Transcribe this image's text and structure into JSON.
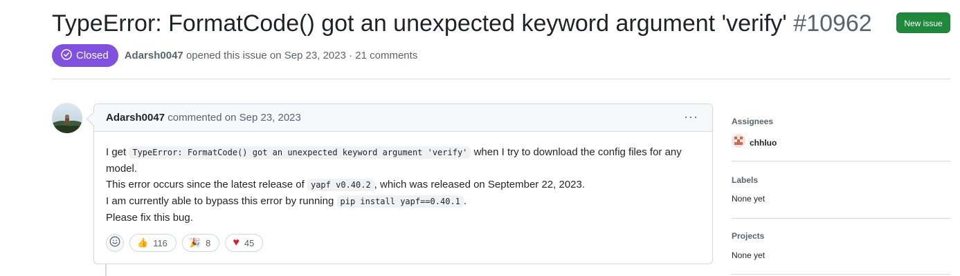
{
  "issue": {
    "title": "TypeError: FormatCode() got an unexpected keyword argument 'verify'",
    "number": "#10962",
    "new_issue_label": "New issue",
    "state": "Closed",
    "author": "Adarsh0047",
    "opened_text": "opened this issue on Sep 23, 2023 · 21 comments"
  },
  "comment": {
    "author": "Adarsh0047",
    "header_text": "commented on Sep 23, 2023",
    "menu_glyph": "···",
    "body": {
      "line1_pre": "I get ",
      "line1_code": "TypeError: FormatCode() got an unexpected keyword argument 'verify'",
      "line1_post": " when I try to download the config files for any model.",
      "line2_pre": "This error occurs since the latest release of ",
      "line2_code": "yapf v0.40.2",
      "line2_post": ", which was released on September 22, 2023.",
      "line3_pre": "I am currently able to bypass this error by running ",
      "line3_code": "pip install yapf==0.40.1",
      "line3_post": ".",
      "line4": "Please fix this bug."
    },
    "reactions": [
      {
        "emoji": "👍",
        "icon": "thumbs-up-icon",
        "count": "116"
      },
      {
        "emoji": "🎉",
        "icon": "party-popper-icon",
        "count": "8"
      },
      {
        "emoji": "♥",
        "icon": "heart-icon",
        "count": "45"
      }
    ]
  },
  "sidebar": {
    "assignees_heading": "Assignees",
    "assignee_name": "chhluo",
    "labels_heading": "Labels",
    "labels_value": "None yet",
    "projects_heading": "Projects",
    "projects_value": "None yet"
  },
  "colors": {
    "closed_badge": "#8250df",
    "new_issue_button": "#1f883d",
    "heart": "#cf222e"
  }
}
